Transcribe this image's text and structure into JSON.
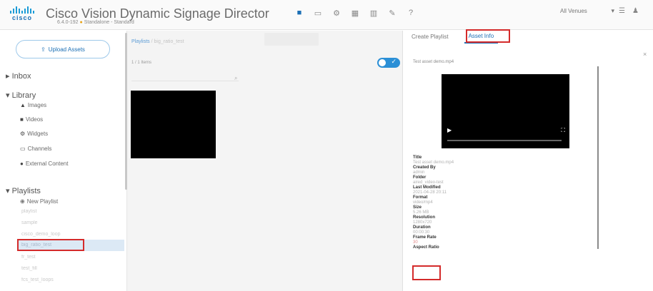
{
  "header": {
    "logo_text": "cisco",
    "title": "Cisco Vision Dynamic Signage Director",
    "version": "6.4.0-192",
    "status": "Standalone - Standard",
    "nav_icons": [
      "video-icon",
      "monitor-icon",
      "gear-icon",
      "grid-icon",
      "chart-icon",
      "wrench-icon",
      "help-icon"
    ],
    "venue_select": "All Venues",
    "user_icons": [
      "settings-icon",
      "user-icon"
    ]
  },
  "sidebar": {
    "upload_label": "Upload Assets",
    "inbox": "Inbox",
    "library": "Library",
    "library_items": [
      "Images",
      "Videos",
      "Widgets",
      "Channels",
      "External Content"
    ],
    "playlists": "Playlists",
    "new_playlist": "New Playlist",
    "playlist_items": [
      "playlist",
      "sample",
      "cisco_demo_loop",
      "big_ratio_test",
      "fr_test",
      "test_fill",
      "fcs_test_loops"
    ]
  },
  "main": {
    "breadcrumb_root": "Playlists",
    "breadcrumb_current": "big_ratio_test",
    "item_count": "1 / 1 Items"
  },
  "panel": {
    "tabs": [
      "Create Playlist",
      "Asset Info"
    ],
    "active_tab": "Asset Info",
    "asset_name": "Test asset demo.mp4",
    "properties": [
      {
        "label": "Title",
        "value": "Test asset demo.mp4"
      },
      {
        "label": "Created By",
        "value": "admin"
      },
      {
        "label": "Folder",
        "value": "aired_video-test"
      },
      {
        "label": "Last Modified",
        "value": "2021-04-28 20:11"
      },
      {
        "label": "Format",
        "value": "video/mp4"
      },
      {
        "label": "Size",
        "value": "5.26 MB"
      },
      {
        "label": "Resolution",
        "value": "1280x720"
      },
      {
        "label": "Duration",
        "value": "00:00:30"
      },
      {
        "label": "Frame Rate",
        "value": "30"
      },
      {
        "label": "Aspect Ratio",
        "value": ""
      }
    ]
  },
  "colors": {
    "accent": "#1b6fb5",
    "highlight_box": "#d42b2b",
    "selected_row": "#dce9f5",
    "toggle": "#2b8fd6"
  }
}
